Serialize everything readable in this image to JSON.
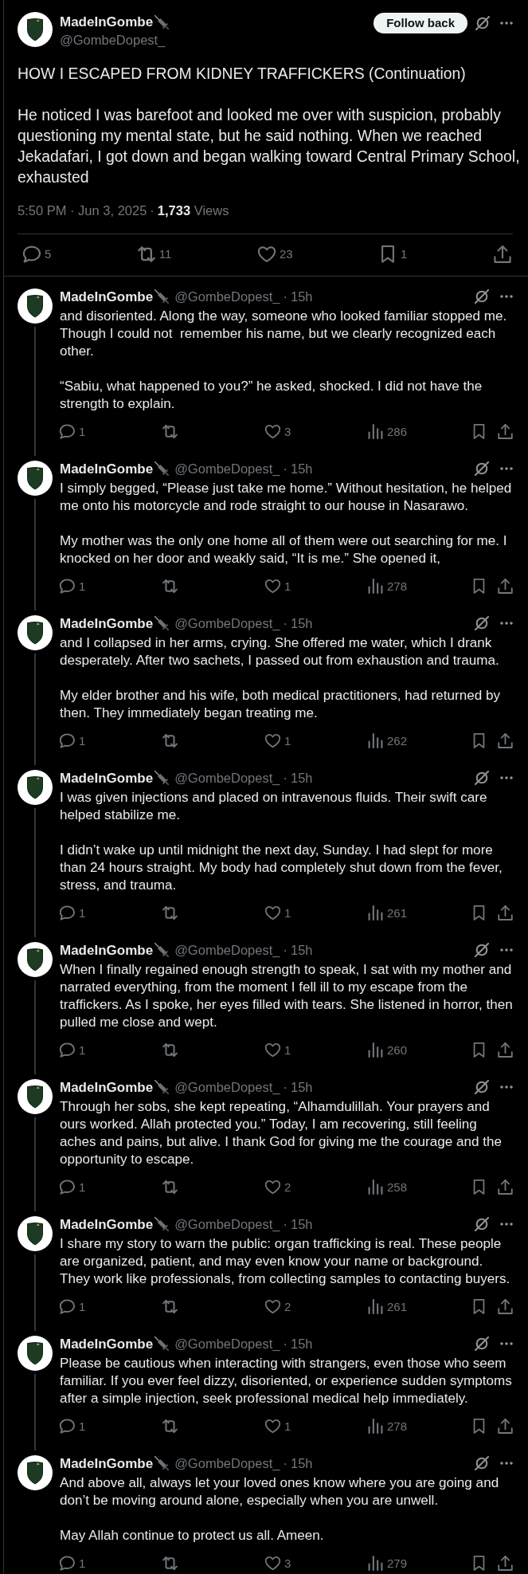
{
  "main_post": {
    "author": {
      "name": "MadeInGombe",
      "handle": "@GombeDopest_"
    },
    "follow_button": "Follow back",
    "paragraphs": [
      "HOW I ESCAPED FROM KIDNEY TRAFFICKERS (Continuation)",
      "He noticed I was barefoot and looked me over with suspicion, probably questioning my mental state, but he said nothing. When we reached Jekadafari, I got down and began walking toward Central Primary School, exhausted"
    ],
    "timestamp": "5:50 PM · Jun 3, 2025",
    "separator": "·",
    "views": "**1,733** Views",
    "actions": [
      {
        "kind": "reply",
        "count": "5"
      },
      {
        "kind": "repost",
        "count": "11"
      },
      {
        "kind": "like",
        "count": "23"
      },
      {
        "kind": "bookmark",
        "count": "1"
      },
      {
        "kind": "share"
      }
    ]
  },
  "replies": [
    {
      "name": "MadeInGombe",
      "handle": "@GombeDopest_",
      "separator": "·",
      "time": "15h",
      "paragraphs": [
        "and disoriented. Along the way, someone who looked familiar stopped me. Though I could not  remember his name, but we clearly recognized each other.",
        "“Sabiu, what happened to you?” he asked, shocked. I did not have the strength to explain."
      ],
      "actions": [
        {
          "kind": "reply",
          "count": "1"
        },
        {
          "kind": "repost"
        },
        {
          "kind": "like",
          "count": "3"
        },
        {
          "kind": "views",
          "count": "286"
        },
        {
          "kind": "bookmark"
        },
        {
          "kind": "share"
        }
      ]
    },
    {
      "name": "MadeInGombe",
      "handle": "@GombeDopest_",
      "separator": "·",
      "time": "15h",
      "paragraphs": [
        "I simply begged, “Please just take me home.” Without hesitation, he helped me onto his motorcycle and rode straight to our house in Nasarawo.",
        "My mother was the only one home all of them were out searching for me. I knocked on her door and weakly said, “It is me.” She opened it,"
      ],
      "actions": [
        {
          "kind": "reply",
          "count": "1"
        },
        {
          "kind": "repost"
        },
        {
          "kind": "like",
          "count": "1"
        },
        {
          "kind": "views",
          "count": "278"
        },
        {
          "kind": "bookmark"
        },
        {
          "kind": "share"
        }
      ]
    },
    {
      "name": "MadeInGombe",
      "handle": "@GombeDopest_",
      "separator": "·",
      "time": "15h",
      "paragraphs": [
        "and I collapsed in her arms, crying. She offered me water, which I drank desperately. After two sachets, I passed out from exhaustion and trauma.",
        "My elder brother and his wife, both medical practitioners, had returned by then. They immediately began treating me."
      ],
      "actions": [
        {
          "kind": "reply",
          "count": "1"
        },
        {
          "kind": "repost"
        },
        {
          "kind": "like",
          "count": "1"
        },
        {
          "kind": "views",
          "count": "262"
        },
        {
          "kind": "bookmark"
        },
        {
          "kind": "share"
        }
      ]
    },
    {
      "name": "MadeInGombe",
      "handle": "@GombeDopest_",
      "separator": "·",
      "time": "15h",
      "paragraphs": [
        "I was given injections and placed on intravenous fluids. Their swift care helped stabilize me.",
        "I didn’t wake up until midnight the next day, Sunday. I had slept for more than 24 hours straight. My body had completely shut down from the fever, stress, and trauma."
      ],
      "actions": [
        {
          "kind": "reply",
          "count": "1"
        },
        {
          "kind": "repost"
        },
        {
          "kind": "like",
          "count": "1"
        },
        {
          "kind": "views",
          "count": "261"
        },
        {
          "kind": "bookmark"
        },
        {
          "kind": "share"
        }
      ]
    },
    {
      "name": "MadeInGombe",
      "handle": "@GombeDopest_",
      "separator": "·",
      "time": "15h",
      "paragraphs": [
        "When I finally regained enough strength to speak, I sat with my mother and narrated everything, from the moment I fell ill to my escape from the traffickers. As I spoke, her eyes filled with tears. She listened in horror, then pulled me close and wept."
      ],
      "actions": [
        {
          "kind": "reply",
          "count": "1"
        },
        {
          "kind": "repost"
        },
        {
          "kind": "like",
          "count": "1"
        },
        {
          "kind": "views",
          "count": "260"
        },
        {
          "kind": "bookmark"
        },
        {
          "kind": "share"
        }
      ]
    },
    {
      "name": "MadeInGombe",
      "handle": "@GombeDopest_",
      "separator": "·",
      "time": "15h",
      "paragraphs": [
        "Through her sobs, she kept repeating, “Alhamdulillah. Your prayers and ours worked. Allah protected you.” Today, I am recovering, still feeling aches and pains, but alive. I thank God for giving me the courage and the opportunity to escape."
      ],
      "actions": [
        {
          "kind": "reply",
          "count": "1"
        },
        {
          "kind": "repost"
        },
        {
          "kind": "like",
          "count": "2"
        },
        {
          "kind": "views",
          "count": "258"
        },
        {
          "kind": "bookmark"
        },
        {
          "kind": "share"
        }
      ]
    },
    {
      "name": "MadeInGombe",
      "handle": "@GombeDopest_",
      "separator": "·",
      "time": "15h",
      "paragraphs": [
        "I share my story to warn the public: organ trafficking is real. These people are organized, patient, and may even know your name or background. They work like professionals, from collecting samples to contacting buyers."
      ],
      "actions": [
        {
          "kind": "reply",
          "count": "1"
        },
        {
          "kind": "repost"
        },
        {
          "kind": "like",
          "count": "2"
        },
        {
          "kind": "views",
          "count": "261"
        },
        {
          "kind": "bookmark"
        },
        {
          "kind": "share"
        }
      ]
    },
    {
      "name": "MadeInGombe",
      "handle": "@GombeDopest_",
      "separator": "·",
      "time": "15h",
      "paragraphs": [
        "Please be cautious when interacting with strangers, even those who seem familiar. If you ever feel dizzy, disoriented, or experience sudden symptoms after a simple injection, seek professional medical help immediately."
      ],
      "actions": [
        {
          "kind": "reply",
          "count": "1"
        },
        {
          "kind": "repost"
        },
        {
          "kind": "like",
          "count": "1"
        },
        {
          "kind": "views",
          "count": "278"
        },
        {
          "kind": "bookmark"
        },
        {
          "kind": "share"
        }
      ]
    },
    {
      "name": "MadeInGombe",
      "handle": "@GombeDopest_",
      "separator": "·",
      "time": "15h",
      "paragraphs": [
        "And above all, always let your loved ones know where you are going and don’t be moving around alone, especially when you are unwell.",
        "May Allah continue to protect us all. Ameen."
      ],
      "actions": [
        {
          "kind": "reply",
          "count": "1"
        },
        {
          "kind": "repost"
        },
        {
          "kind": "like",
          "count": "3"
        },
        {
          "kind": "views",
          "count": "279"
        },
        {
          "kind": "bookmark"
        },
        {
          "kind": "share"
        }
      ]
    }
  ]
}
